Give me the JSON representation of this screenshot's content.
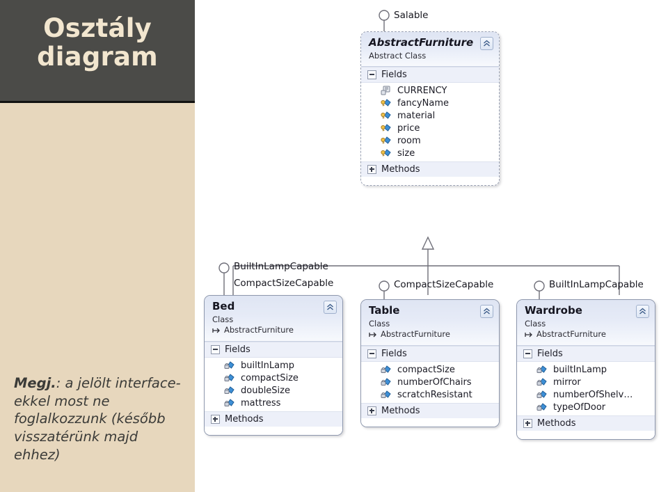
{
  "slide": {
    "title": "Osztály\ndiagram",
    "note_prefix": "Megj.",
    "note_text": ": a jelölt interface-ekkel most ne foglalkozzunk (később visszatérünk majd ehhez)",
    "colors": {
      "title_bg": "#4b4b48",
      "title_fg": "#f2e6cf",
      "sidebar_bg": "#e7d7bd",
      "canvas_bg": "#ffffff",
      "class_header": "#dfe5f3",
      "section_row": "#edf0f9",
      "border": "#8d97ad"
    }
  },
  "diagram": {
    "type": "uml-class-diagram",
    "classes": [
      {
        "id": "abstract-furniture",
        "name": "AbstractFurniture",
        "kind": "Abstract Class",
        "base": null,
        "abstract": true,
        "sections": [
          {
            "label": "Fields",
            "expanded": true
          },
          {
            "label": "Methods",
            "expanded": false
          }
        ],
        "fields": [
          {
            "name": "CURRENCY",
            "icon": "const-icon"
          },
          {
            "name": "fancyName",
            "icon": "protected-field-icon"
          },
          {
            "name": "material",
            "icon": "protected-field-icon"
          },
          {
            "name": "price",
            "icon": "protected-field-icon"
          },
          {
            "name": "room",
            "icon": "protected-field-icon"
          },
          {
            "name": "size",
            "icon": "protected-field-icon"
          }
        ],
        "interfaces": [
          "Salable"
        ]
      },
      {
        "id": "bed",
        "name": "Bed",
        "kind": "Class",
        "base": "AbstractFurniture",
        "abstract": false,
        "sections": [
          {
            "label": "Fields",
            "expanded": true
          },
          {
            "label": "Methods",
            "expanded": false
          }
        ],
        "fields": [
          {
            "name": "builtInLamp",
            "icon": "private-field-icon"
          },
          {
            "name": "compactSize",
            "icon": "private-field-icon"
          },
          {
            "name": "doubleSize",
            "icon": "private-field-icon"
          },
          {
            "name": "mattress",
            "icon": "private-field-icon"
          }
        ],
        "interfaces": [
          "BuiltInLampCapable",
          "CompactSizeCapable"
        ]
      },
      {
        "id": "table",
        "name": "Table",
        "kind": "Class",
        "base": "AbstractFurniture",
        "abstract": false,
        "sections": [
          {
            "label": "Fields",
            "expanded": true
          },
          {
            "label": "Methods",
            "expanded": false
          }
        ],
        "fields": [
          {
            "name": "compactSize",
            "icon": "private-field-icon"
          },
          {
            "name": "numberOfChairs",
            "icon": "private-field-icon"
          },
          {
            "name": "scratchResistant",
            "icon": "private-field-icon"
          }
        ],
        "interfaces": [
          "CompactSizeCapable"
        ]
      },
      {
        "id": "wardrobe",
        "name": "Wardrobe",
        "kind": "Class",
        "base": "AbstractFurniture",
        "abstract": false,
        "sections": [
          {
            "label": "Fields",
            "expanded": true
          },
          {
            "label": "Methods",
            "expanded": false
          }
        ],
        "fields": [
          {
            "name": "builtInLamp",
            "icon": "private-field-icon"
          },
          {
            "name": "mirror",
            "icon": "private-field-icon"
          },
          {
            "name": "numberOfShelv…",
            "icon": "private-field-icon"
          },
          {
            "name": "typeOfDoor",
            "icon": "private-field-icon"
          }
        ],
        "interfaces": [
          "BuiltInLampCapable"
        ]
      }
    ]
  }
}
